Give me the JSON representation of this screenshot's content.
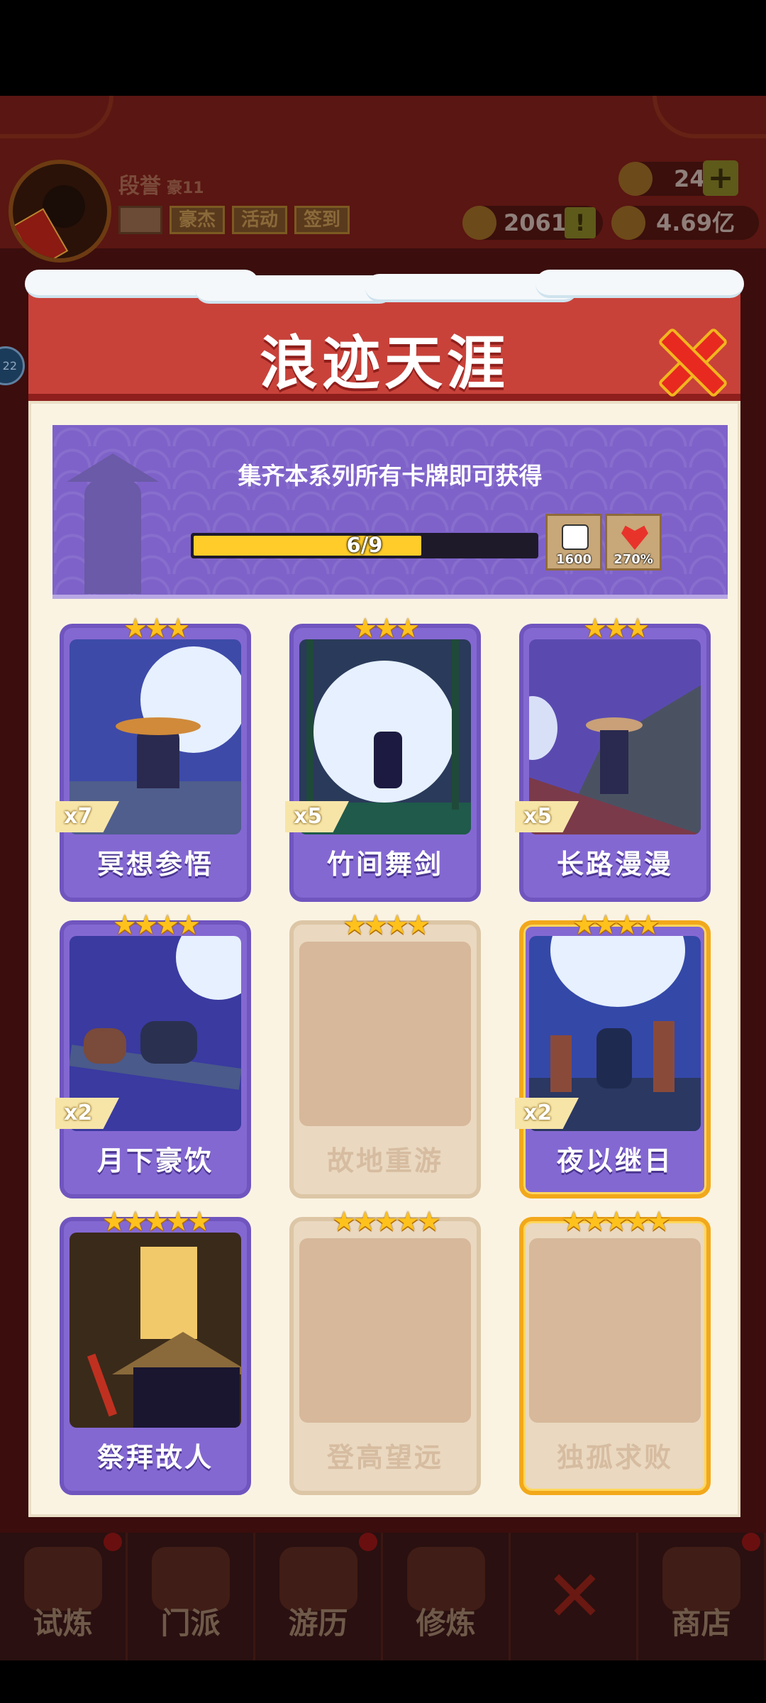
{
  "hud": {
    "player_name": "段誉",
    "level": "豪11",
    "buttons": [
      "豪杰",
      "活动",
      "签到"
    ],
    "gems": "24",
    "tokens": "2061",
    "coins": "4.69亿",
    "side_badge": "22"
  },
  "modal": {
    "title": "浪迹天涯",
    "banner_text": "集齐本系列所有卡牌即可获得",
    "progress_text": "6/9",
    "progress_fraction": 0.667,
    "rewards": [
      {
        "icon": "dice-icon",
        "value": "1600"
      },
      {
        "icon": "heart-icon",
        "value": "270%"
      }
    ]
  },
  "cards": [
    {
      "name": "冥想参悟",
      "stars": "★★★",
      "count": "x7"
    },
    {
      "name": "竹间舞剑",
      "stars": "★★★",
      "count": "x5"
    },
    {
      "name": "长路漫漫",
      "stars": "★★★",
      "count": "x5"
    },
    {
      "name": "月下豪饮",
      "stars": "★★★★",
      "count": "x2"
    },
    {
      "name": "故地重游",
      "stars": "★★★★",
      "count": ""
    },
    {
      "name": "夜以继日",
      "stars": "★★★★",
      "count": "x2"
    },
    {
      "name": "祭拜故人",
      "stars": "★★★★★",
      "count": ""
    },
    {
      "name": "登高望远",
      "stars": "★★★★★",
      "count": ""
    },
    {
      "name": "独孤求败",
      "stars": "★★★★★",
      "count": ""
    }
  ],
  "nav": [
    "试炼",
    "门派",
    "游历",
    "修炼",
    "",
    "商店"
  ]
}
